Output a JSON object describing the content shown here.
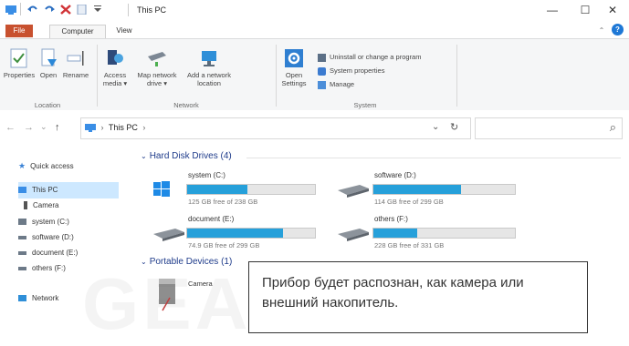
{
  "window": {
    "title": "This PC",
    "minimize_glyph": "—",
    "maximize_glyph": "☐",
    "close_glyph": "✕"
  },
  "ribbon_tabs": {
    "file": "File",
    "computer": "Computer",
    "view": "View",
    "collapse_glyph": "⌃",
    "help_glyph": "?"
  },
  "ribbon": {
    "location": {
      "label": "Location",
      "properties": "Properties",
      "open": "Open",
      "rename": "Rename"
    },
    "network": {
      "label": "Network",
      "access_media_1": "Access",
      "access_media_2": "media ▾",
      "map_drive_1": "Map network",
      "map_drive_2": "drive ▾",
      "add_location_1": "Add a network",
      "add_location_2": "location"
    },
    "system": {
      "label": "System",
      "open_settings_1": "Open",
      "open_settings_2": "Settings",
      "uninstall": "Uninstall or change a program",
      "system_properties": "System properties",
      "manage": "Manage"
    }
  },
  "address_bar": {
    "back": "←",
    "forward": "→",
    "recent": "⌄",
    "up": "↑",
    "path": "This PC",
    "path_chevron": "›",
    "path_chevron_end": "›",
    "dropdown": "⌄",
    "refresh": "↻",
    "search_icon": "⌕"
  },
  "nav_pane": {
    "quick_access": "Quick access",
    "this_pc": "This PC",
    "camera": "Camera",
    "system": "system (C:)",
    "software": "software (D:)",
    "document": "document (E:)",
    "others": "others (F:)",
    "network": "Network"
  },
  "content": {
    "hard_disk_header": "Hard Disk Drives (4)",
    "portable_header": "Portable Devices (1)",
    "camera_label": "Camera",
    "drives": [
      {
        "name": "system (C:)",
        "free": "125 GB free of 238 GB",
        "used_fraction": 0.47
      },
      {
        "name": "software (D:)",
        "free": "114 GB free of 299 GB",
        "used_fraction": 0.62
      },
      {
        "name": "document (E:)",
        "free": "74.9 GB free of 299 GB",
        "used_fraction": 0.75
      },
      {
        "name": "others (F:)",
        "free": "228 GB free of 331 GB",
        "used_fraction": 0.31
      }
    ]
  },
  "callout": {
    "text": "Прибор будет распознан, как камера или внешний накопитель."
  },
  "watermark": "GEARY.RU",
  "colors": {
    "accent": "#26a0da",
    "file_tab": "#c8512f",
    "selection": "#cde8ff",
    "section_header": "#1e3b8a"
  }
}
